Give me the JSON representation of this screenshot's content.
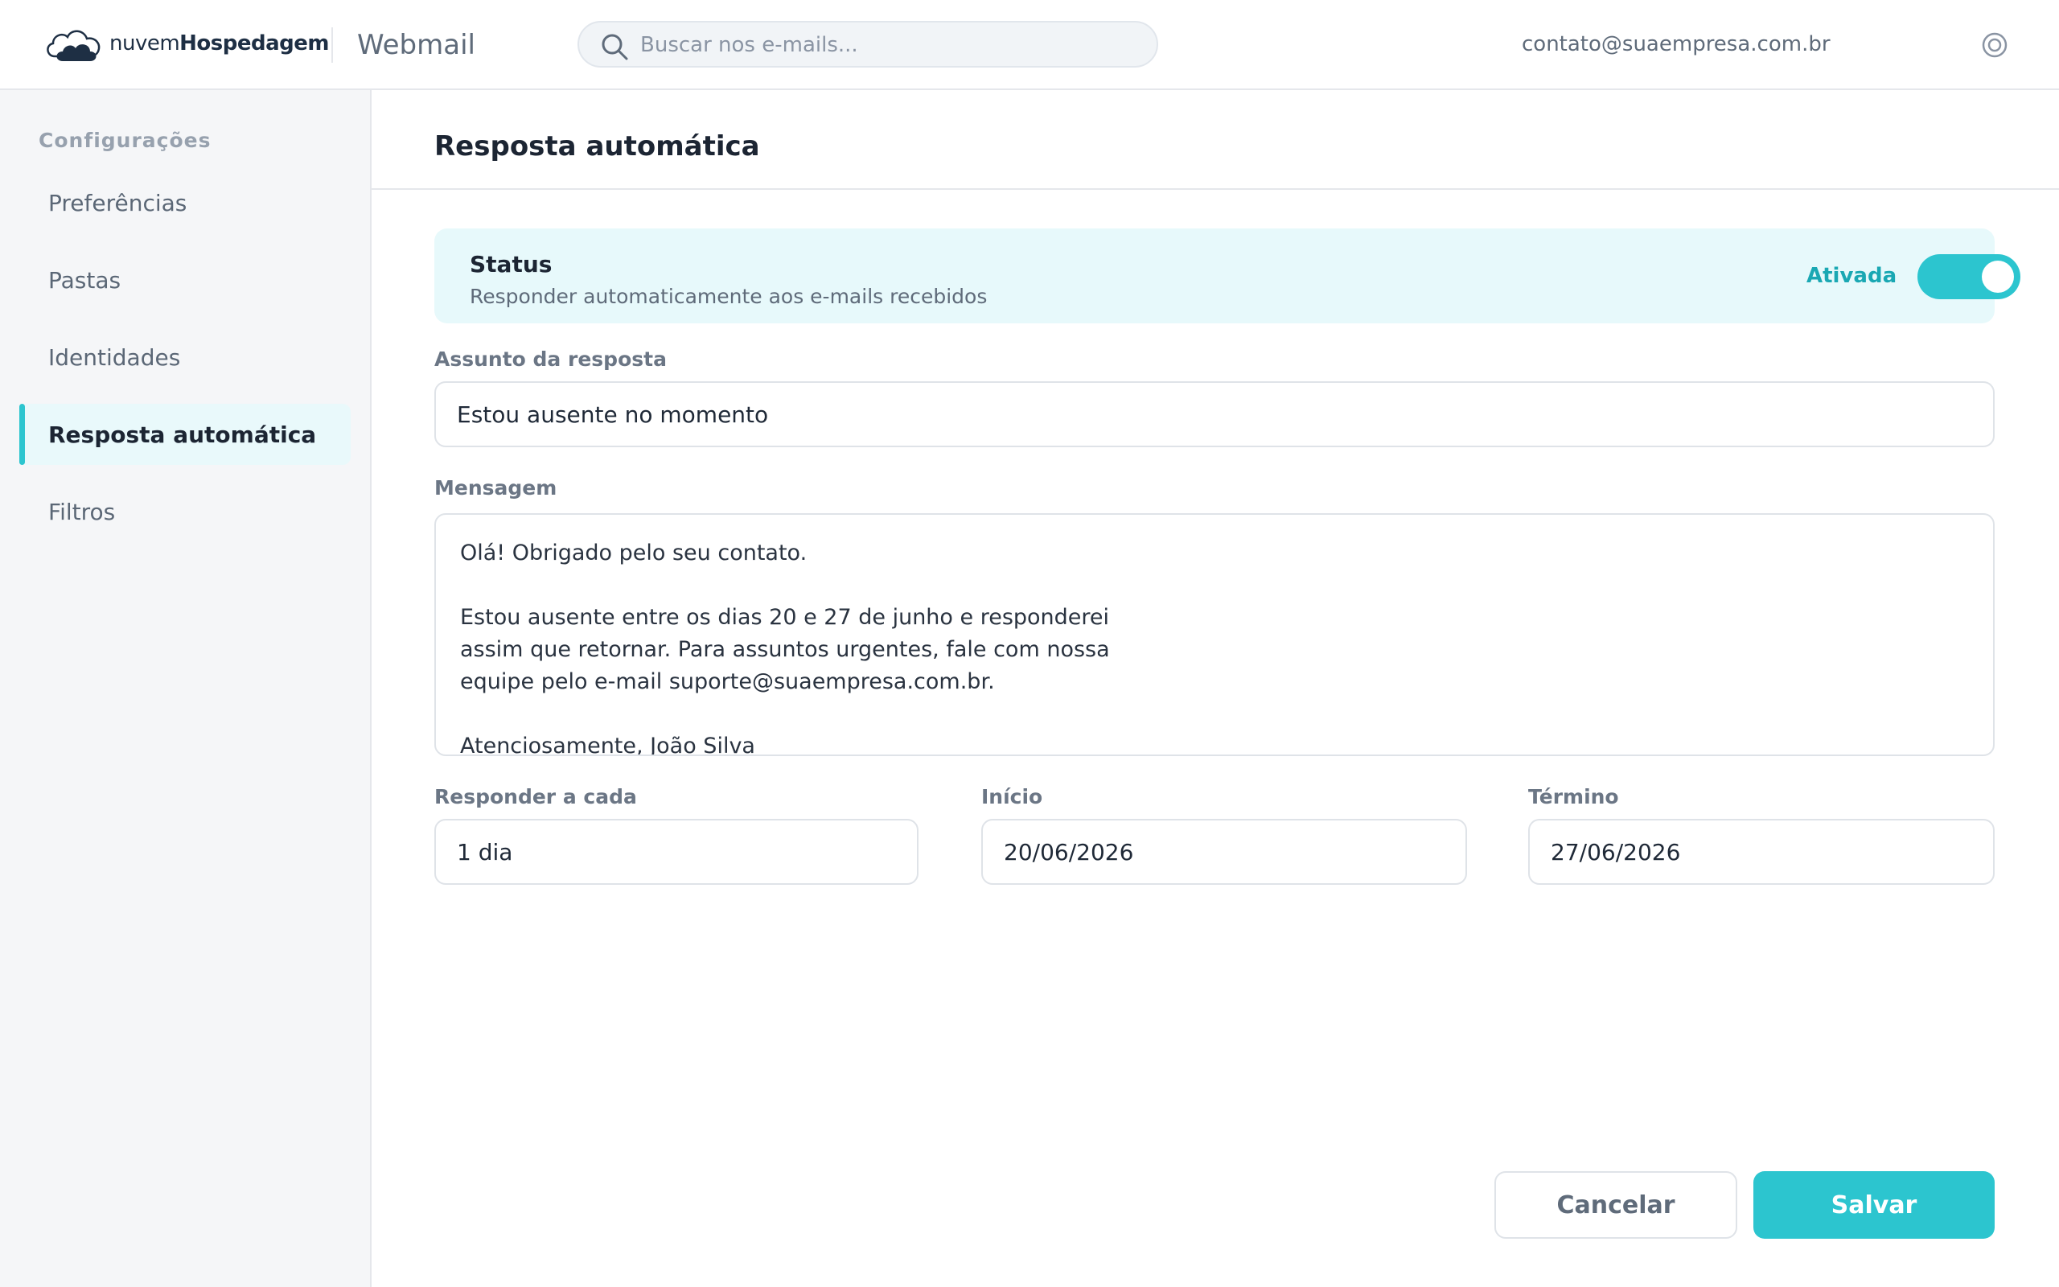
{
  "brand": {
    "logo_light": "nuvem",
    "logo_bold": "Hospedagem",
    "app_name": "Webmail",
    "logo_icon": "cloud-icon"
  },
  "header": {
    "search_placeholder": "Buscar nos e-mails...",
    "search_icon": "search-icon",
    "account_email": "contato@suaempresa.com.br",
    "settings_icon": "settings-icon"
  },
  "sidebar": {
    "heading": "Configurações",
    "items": [
      {
        "label": "Preferências",
        "active": false
      },
      {
        "label": "Pastas",
        "active": false
      },
      {
        "label": "Identidades",
        "active": false
      },
      {
        "label": "Resposta automática",
        "active": true
      },
      {
        "label": "Filtros",
        "active": false
      }
    ]
  },
  "main": {
    "title": "Resposta automática",
    "status": {
      "title": "Status",
      "description": "Responder automaticamente aos e-mails recebidos",
      "state_label": "Ativada",
      "enabled": true
    },
    "subject": {
      "label": "Assunto da resposta",
      "value": "Estou ausente no momento"
    },
    "message": {
      "label": "Mensagem",
      "value": "Olá! Obrigado pelo seu contato.\n\nEstou ausente entre os dias 20 e 27 de junho e responderei\nassim que retornar. Para assuntos urgentes, fale com nossa\nequipe pelo e-mail suporte@suaempresa.com.br.\n\nAtenciosamente, João Silva"
    },
    "interval": {
      "label": "Responder a cada",
      "value": "1 dia"
    },
    "start": {
      "label": "Início",
      "value": "20/06/2026"
    },
    "end": {
      "label": "Término",
      "value": "27/06/2026"
    },
    "buttons": {
      "cancel": "Cancelar",
      "save": "Salvar"
    }
  },
  "colors": {
    "accent": "#2cc5cf",
    "accent_text": "#1aa8b3",
    "status_bg": "#e7f9fb",
    "brand_dark": "#1e2f44"
  }
}
